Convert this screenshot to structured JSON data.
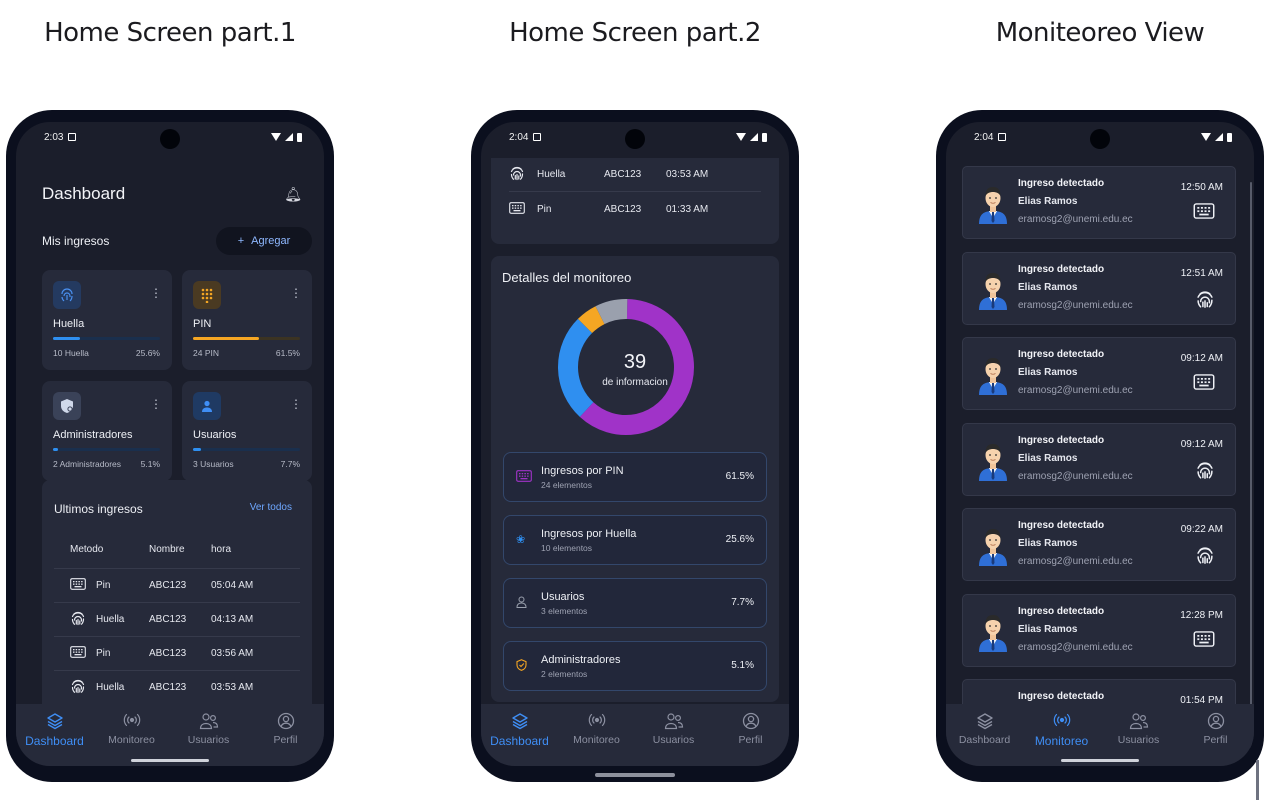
{
  "captions": [
    "Home Screen part.1",
    "Home Screen part.2",
    "Moniteoreo View"
  ],
  "colors": {
    "accent": "#3f8ef5",
    "purple": "#a033c8",
    "blue": "#2f8ff0",
    "orange": "#f5a623",
    "gray": "#9aa0ad",
    "bg": "#1b1e2b",
    "card": "#262a3a"
  },
  "phone1": {
    "status_time": "2:03",
    "title": "Dashboard",
    "mis_ingresos": "Mis ingresos",
    "agregar": "Agregar",
    "tiles": [
      {
        "name": "Huella",
        "count": "10 Huella",
        "pct": "25.6%",
        "fraction": 0.256,
        "color": "#2f8ff0",
        "icon": "fingerprint-icon"
      },
      {
        "name": "PIN",
        "count": "24 PIN",
        "pct": "61.5%",
        "fraction": 0.615,
        "color": "#f5a623",
        "icon": "keypad-icon"
      },
      {
        "name": "Administradores",
        "count": "2 Administradores",
        "pct": "5.1%",
        "fraction": 0.051,
        "color": "#2f8ff0",
        "icon": "shield-icon"
      },
      {
        "name": "Usuarios",
        "count": "3 Usuarios",
        "pct": "7.7%",
        "fraction": 0.077,
        "color": "#2f8ff0",
        "icon": "person-icon"
      }
    ],
    "ultimos": "Ultimos ingresos",
    "ver_todos": "Ver todos",
    "headers": [
      "Metodo",
      "Nombre",
      "hora"
    ],
    "rows": [
      {
        "metodo": "Pin",
        "nombre": "ABC123",
        "hora": "05:04 AM",
        "icon": "keyboard-icon"
      },
      {
        "metodo": "Huella",
        "nombre": "ABC123",
        "hora": "04:13 AM",
        "icon": "fingerprint-icon"
      },
      {
        "metodo": "Pin",
        "nombre": "ABC123",
        "hora": "03:56 AM",
        "icon": "keyboard-icon"
      },
      {
        "metodo": "Huella",
        "nombre": "ABC123",
        "hora": "03:53 AM",
        "icon": "fingerprint-icon"
      }
    ]
  },
  "nav": [
    "Dashboard",
    "Monitoreo",
    "Usuarios",
    "Perfil"
  ],
  "phone2": {
    "status_time": "2:04",
    "rows": [
      {
        "metodo": "Huella",
        "nombre": "ABC123",
        "hora": "03:53 AM",
        "icon": "fingerprint-icon"
      },
      {
        "metodo": "Pin",
        "nombre": "ABC123",
        "hora": "01:33 AM",
        "icon": "keyboard-icon"
      }
    ],
    "detalles": "Detalles del monitoreo",
    "center_value": "39",
    "center_label": "de informacion",
    "donut": [
      {
        "label": "Ingresos por PIN",
        "value": 61.5,
        "color": "#a033c8"
      },
      {
        "label": "Ingresos por Huella",
        "value": 25.6,
        "color": "#2f8ff0"
      },
      {
        "label": "Administradores",
        "value": 5.1,
        "color": "#f5a623"
      },
      {
        "label": "Usuarios",
        "value": 7.7,
        "color": "#9aa0ad"
      }
    ],
    "legend": [
      {
        "title": "Ingresos por PIN",
        "sub": "24 elementos",
        "pct": "61.5%",
        "color": "#a033c8",
        "icon": "keyboard-icon"
      },
      {
        "title": "Ingresos por Huella",
        "sub": "10 elementos",
        "pct": "25.6%",
        "color": "#2f8ff0",
        "icon": "fingerprint-icon"
      },
      {
        "title": "Usuarios",
        "sub": "3 elementos",
        "pct": "7.7%",
        "color": "#9aa0ad",
        "icon": "person-icon"
      },
      {
        "title": "Administradores",
        "sub": "2 elementos",
        "pct": "5.1%",
        "color": "#f5a623",
        "icon": "shield-icon"
      }
    ]
  },
  "phone3": {
    "status_time": "2:04",
    "notifications": [
      {
        "title": "Ingreso detectado",
        "name": "Elias Ramos",
        "email": "eramosg2@unemi.edu.ec",
        "time": "12:50 AM",
        "method_icon": "keyboard-icon"
      },
      {
        "title": "Ingreso detectado",
        "name": "Elias Ramos",
        "email": "eramosg2@unemi.edu.ec",
        "time": "12:51 AM",
        "method_icon": "fingerprint-icon"
      },
      {
        "title": "Ingreso detectado",
        "name": "Elias Ramos",
        "email": "eramosg2@unemi.edu.ec",
        "time": "09:12 AM",
        "method_icon": "keyboard-icon"
      },
      {
        "title": "Ingreso detectado",
        "name": "Elias Ramos",
        "email": "eramosg2@unemi.edu.ec",
        "time": "09:12 AM",
        "method_icon": "fingerprint-icon"
      },
      {
        "title": "Ingreso detectado",
        "name": "Elias Ramos",
        "email": "eramosg2@unemi.edu.ec",
        "time": "09:22 AM",
        "method_icon": "fingerprint-icon"
      },
      {
        "title": "Ingreso detectado",
        "name": "Elias Ramos",
        "email": "eramosg2@unemi.edu.ec",
        "time": "12:28 PM",
        "method_icon": "keyboard-icon"
      },
      {
        "title": "Ingreso detectado",
        "name": "",
        "email": "",
        "time": "01:54 PM",
        "method_icon": ""
      }
    ]
  }
}
